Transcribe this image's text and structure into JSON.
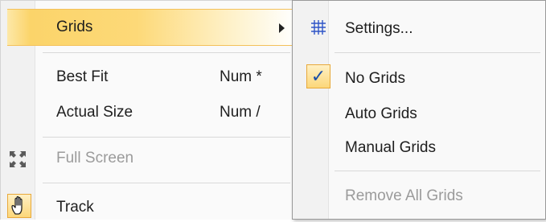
{
  "main_menu": {
    "items": [
      {
        "label": "Grids"
      },
      {
        "label": "Best Fit",
        "shortcut": "Num *"
      },
      {
        "label": "Actual Size",
        "shortcut": "Num /"
      },
      {
        "label": "Full Screen"
      },
      {
        "label": "Track"
      }
    ]
  },
  "grids_submenu": {
    "items": [
      {
        "label": "Settings..."
      },
      {
        "label": "No Grids",
        "checked": true
      },
      {
        "label": "Auto Grids"
      },
      {
        "label": "Manual Grids"
      },
      {
        "label": "Remove All Grids"
      }
    ]
  },
  "icons": {
    "fullscreen": "fullscreen-icon",
    "track": "hand-icon",
    "settings": "grid-icon",
    "check": "checkmark-icon"
  },
  "colors": {
    "highlight": "#fbd46a",
    "check_border": "#e8a93a",
    "check_mark": "#1a4ea8",
    "grid_icon": "#2f55c8"
  },
  "check_glyph": "✓"
}
